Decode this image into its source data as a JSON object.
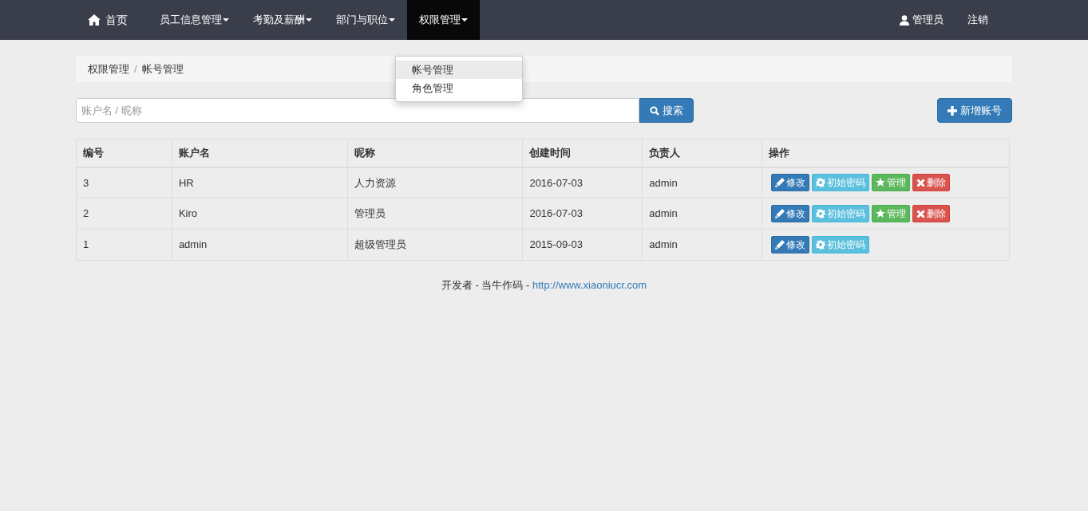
{
  "navbar": {
    "home": "首页",
    "menus": [
      {
        "label": "员工信息管理",
        "selected": false
      },
      {
        "label": "考勤及薪酬",
        "selected": false
      },
      {
        "label": "部门与职位",
        "selected": false
      },
      {
        "label": "权限管理",
        "selected": true
      }
    ],
    "user": "管理员",
    "logout": "注销"
  },
  "dropdown": {
    "items": [
      {
        "label": "帐号管理",
        "selected": true
      },
      {
        "label": "角色管理",
        "selected": false
      }
    ]
  },
  "breadcrumb": {
    "separator": "/",
    "items": [
      "权限管理",
      "帐号管理"
    ]
  },
  "search": {
    "placeholder": "账户名 / 昵称",
    "button": "搜索"
  },
  "add_button": "新增账号",
  "table": {
    "columns": [
      "编号",
      "账户名",
      "昵称",
      "创建时间",
      "负责人",
      "操作"
    ],
    "rows": [
      {
        "cells": [
          "3",
          "HR",
          "人力资源",
          "2016-07-03",
          "admin"
        ],
        "actions": [
          {
            "kind": "edit",
            "label": "修改"
          },
          {
            "kind": "reset",
            "label": "初始密码"
          },
          {
            "kind": "manage",
            "label": "管理"
          },
          {
            "kind": "delete",
            "label": "删除"
          }
        ]
      },
      {
        "cells": [
          "2",
          "Kiro",
          "管理员",
          "2016-07-03",
          "admin"
        ],
        "actions": [
          {
            "kind": "edit",
            "label": "修改"
          },
          {
            "kind": "reset",
            "label": "初始密码"
          },
          {
            "kind": "manage",
            "label": "管理"
          },
          {
            "kind": "delete",
            "label": "删除"
          }
        ]
      },
      {
        "cells": [
          "1",
          "admin",
          "超级管理员",
          "2015-09-03",
          "admin"
        ],
        "actions": [
          {
            "kind": "edit",
            "label": "修改"
          },
          {
            "kind": "reset",
            "label": "初始密码"
          }
        ]
      }
    ]
  },
  "footer": {
    "text": "开发者 - 当牛作码 - ",
    "link": "http://www.xiaoniucr.com"
  }
}
